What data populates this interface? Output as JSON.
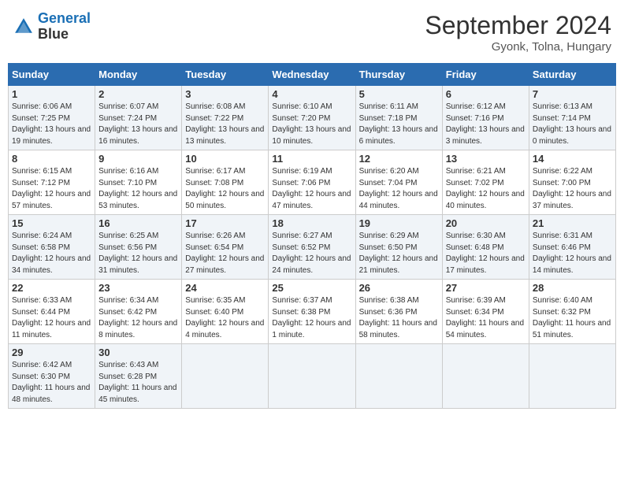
{
  "header": {
    "logo_line1": "General",
    "logo_line2": "Blue",
    "month": "September 2024",
    "location": "Gyonk, Tolna, Hungary"
  },
  "days_of_week": [
    "Sunday",
    "Monday",
    "Tuesday",
    "Wednesday",
    "Thursday",
    "Friday",
    "Saturday"
  ],
  "weeks": [
    [
      {
        "day": 1,
        "sunrise": "6:06 AM",
        "sunset": "7:25 PM",
        "daylight": "13 hours and 19 minutes."
      },
      {
        "day": 2,
        "sunrise": "6:07 AM",
        "sunset": "7:24 PM",
        "daylight": "13 hours and 16 minutes."
      },
      {
        "day": 3,
        "sunrise": "6:08 AM",
        "sunset": "7:22 PM",
        "daylight": "13 hours and 13 minutes."
      },
      {
        "day": 4,
        "sunrise": "6:10 AM",
        "sunset": "7:20 PM",
        "daylight": "13 hours and 10 minutes."
      },
      {
        "day": 5,
        "sunrise": "6:11 AM",
        "sunset": "7:18 PM",
        "daylight": "13 hours and 6 minutes."
      },
      {
        "day": 6,
        "sunrise": "6:12 AM",
        "sunset": "7:16 PM",
        "daylight": "13 hours and 3 minutes."
      },
      {
        "day": 7,
        "sunrise": "6:13 AM",
        "sunset": "7:14 PM",
        "daylight": "13 hours and 0 minutes."
      }
    ],
    [
      {
        "day": 8,
        "sunrise": "6:15 AM",
        "sunset": "7:12 PM",
        "daylight": "12 hours and 57 minutes."
      },
      {
        "day": 9,
        "sunrise": "6:16 AM",
        "sunset": "7:10 PM",
        "daylight": "12 hours and 53 minutes."
      },
      {
        "day": 10,
        "sunrise": "6:17 AM",
        "sunset": "7:08 PM",
        "daylight": "12 hours and 50 minutes."
      },
      {
        "day": 11,
        "sunrise": "6:19 AM",
        "sunset": "7:06 PM",
        "daylight": "12 hours and 47 minutes."
      },
      {
        "day": 12,
        "sunrise": "6:20 AM",
        "sunset": "7:04 PM",
        "daylight": "12 hours and 44 minutes."
      },
      {
        "day": 13,
        "sunrise": "6:21 AM",
        "sunset": "7:02 PM",
        "daylight": "12 hours and 40 minutes."
      },
      {
        "day": 14,
        "sunrise": "6:22 AM",
        "sunset": "7:00 PM",
        "daylight": "12 hours and 37 minutes."
      }
    ],
    [
      {
        "day": 15,
        "sunrise": "6:24 AM",
        "sunset": "6:58 PM",
        "daylight": "12 hours and 34 minutes."
      },
      {
        "day": 16,
        "sunrise": "6:25 AM",
        "sunset": "6:56 PM",
        "daylight": "12 hours and 31 minutes."
      },
      {
        "day": 17,
        "sunrise": "6:26 AM",
        "sunset": "6:54 PM",
        "daylight": "12 hours and 27 minutes."
      },
      {
        "day": 18,
        "sunrise": "6:27 AM",
        "sunset": "6:52 PM",
        "daylight": "12 hours and 24 minutes."
      },
      {
        "day": 19,
        "sunrise": "6:29 AM",
        "sunset": "6:50 PM",
        "daylight": "12 hours and 21 minutes."
      },
      {
        "day": 20,
        "sunrise": "6:30 AM",
        "sunset": "6:48 PM",
        "daylight": "12 hours and 17 minutes."
      },
      {
        "day": 21,
        "sunrise": "6:31 AM",
        "sunset": "6:46 PM",
        "daylight": "12 hours and 14 minutes."
      }
    ],
    [
      {
        "day": 22,
        "sunrise": "6:33 AM",
        "sunset": "6:44 PM",
        "daylight": "12 hours and 11 minutes."
      },
      {
        "day": 23,
        "sunrise": "6:34 AM",
        "sunset": "6:42 PM",
        "daylight": "12 hours and 8 minutes."
      },
      {
        "day": 24,
        "sunrise": "6:35 AM",
        "sunset": "6:40 PM",
        "daylight": "12 hours and 4 minutes."
      },
      {
        "day": 25,
        "sunrise": "6:37 AM",
        "sunset": "6:38 PM",
        "daylight": "12 hours and 1 minute."
      },
      {
        "day": 26,
        "sunrise": "6:38 AM",
        "sunset": "6:36 PM",
        "daylight": "11 hours and 58 minutes."
      },
      {
        "day": 27,
        "sunrise": "6:39 AM",
        "sunset": "6:34 PM",
        "daylight": "11 hours and 54 minutes."
      },
      {
        "day": 28,
        "sunrise": "6:40 AM",
        "sunset": "6:32 PM",
        "daylight": "11 hours and 51 minutes."
      }
    ],
    [
      {
        "day": 29,
        "sunrise": "6:42 AM",
        "sunset": "6:30 PM",
        "daylight": "11 hours and 48 minutes."
      },
      {
        "day": 30,
        "sunrise": "6:43 AM",
        "sunset": "6:28 PM",
        "daylight": "11 hours and 45 minutes."
      },
      null,
      null,
      null,
      null,
      null
    ]
  ]
}
